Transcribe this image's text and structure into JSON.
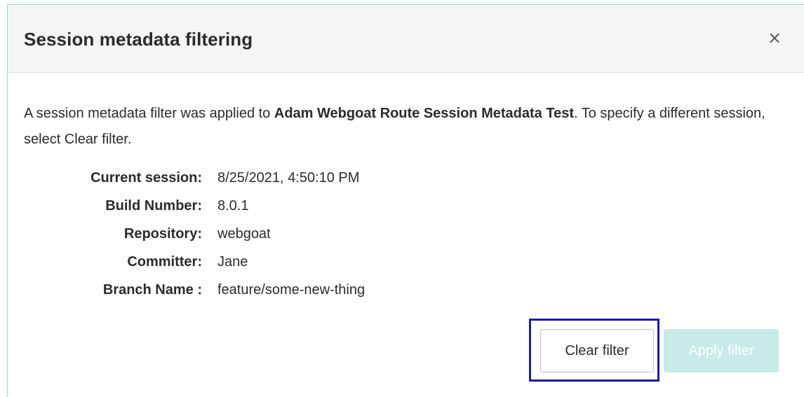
{
  "dialog": {
    "title": "Session metadata filtering",
    "close_glyph": "×",
    "close_icon": "close-icon"
  },
  "intro": {
    "prefix": "A session metadata filter was applied to ",
    "session_name": "Adam Webgoat Route Session Metadata Test",
    "suffix": ". To specify a different session, select Clear filter."
  },
  "metadata": [
    {
      "label": "Current session:",
      "value": "8/25/2021, 4:50:10 PM"
    },
    {
      "label": "Build Number:",
      "value": "8.0.1"
    },
    {
      "label": "Repository:",
      "value": "webgoat"
    },
    {
      "label": "Committer:",
      "value": "Jane"
    },
    {
      "label": "Branch Name :",
      "value": "feature/some-new-thing"
    }
  ],
  "buttons": {
    "clear_label": "Clear filter",
    "apply_label": "Apply filter",
    "apply_disabled": true
  },
  "colors": {
    "accent_border": "#9fd8cf",
    "apply_bg_disabled": "#c7ebe6",
    "focus_ring": "#1a1aa8"
  }
}
